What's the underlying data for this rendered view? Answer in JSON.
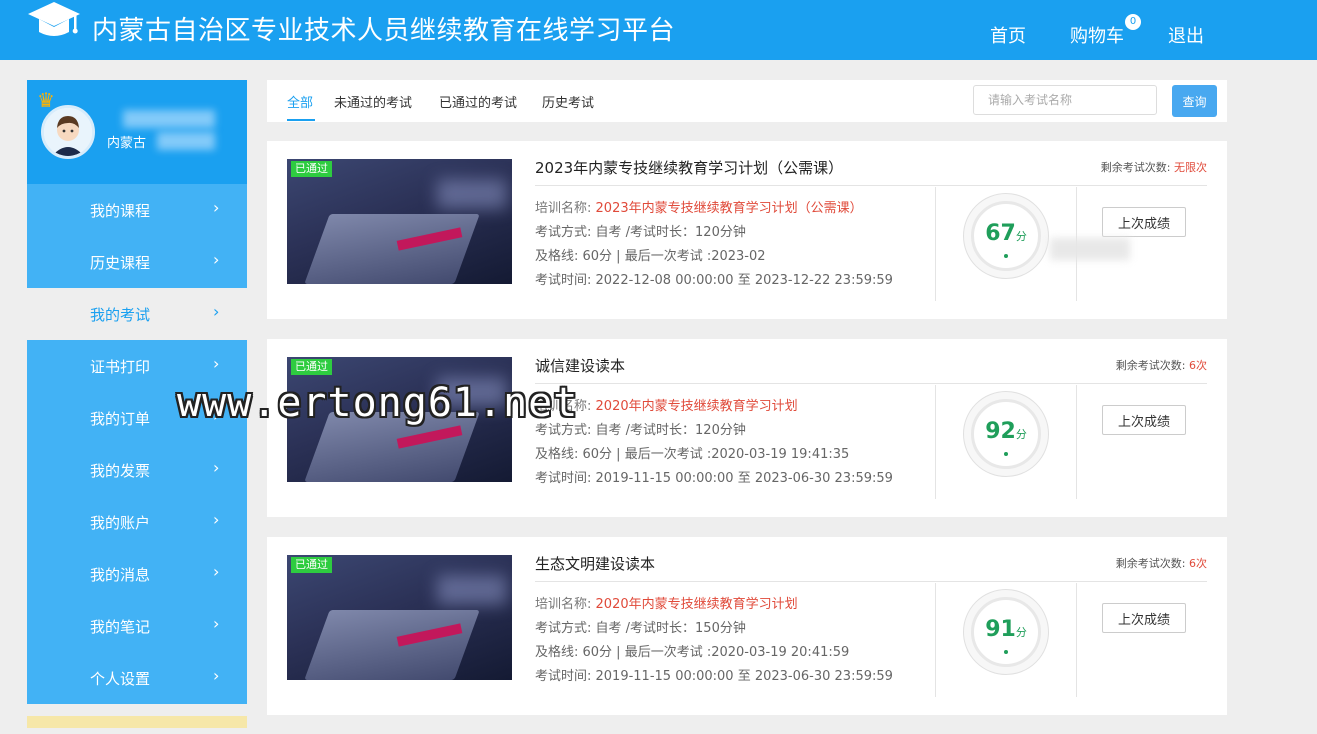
{
  "header": {
    "title": "内蒙古自治区专业技术人员继续教育在线学习平台",
    "logo_icon": "graduation-cap-icon",
    "nav": {
      "home": "首页",
      "cart": "购物车",
      "cart_count": "0",
      "logout": "退出"
    },
    "colors": {
      "primary": "#1aa0f0",
      "menu": "#42b2f5"
    }
  },
  "profile": {
    "username": "内蒙古",
    "avatar_icon": "user-avatar-icon",
    "badge_icon": "crown-icon"
  },
  "sidebar": {
    "items": [
      {
        "label": "我的课程"
      },
      {
        "label": "历史课程"
      },
      {
        "label": "我的考试"
      },
      {
        "label": "证书打印"
      },
      {
        "label": "我的订单"
      },
      {
        "label": "我的发票"
      },
      {
        "label": "我的账户"
      },
      {
        "label": "我的消息"
      },
      {
        "label": "我的笔记"
      },
      {
        "label": "个人设置"
      }
    ],
    "active_index": 2,
    "arrow": "›"
  },
  "tabs": {
    "items": [
      "全部",
      "未通过的考试",
      "已通过的考试",
      "历史考试"
    ],
    "active_index": 0
  },
  "search": {
    "placeholder": "请输入考试名称",
    "button": "查询"
  },
  "exams": [
    {
      "tag": "已通过",
      "title": "2023年内蒙专技继续教育学习计划（公需课）",
      "remain_label": "剩余考试次数:",
      "remain_value": "无限次",
      "training_label": "培训名称:",
      "training_name": "2023年内蒙专技继续教育学习计划（公需课）",
      "method_line": "考试方式: 自考 /考试时长：120分钟",
      "pass_line": "及格线: 60分 | 最后一次考试 :2023-02",
      "time_line": "考试时间: 2022-12-08 00:00:00 至 2023-12-22 23:59:59",
      "score": "67",
      "score_unit": "分",
      "button": "上次成绩"
    },
    {
      "tag": "已通过",
      "title": "诚信建设读本",
      "remain_label": "剩余考试次数:",
      "remain_value": "6次",
      "training_label": "培训名称:",
      "training_name": "2020年内蒙专技继续教育学习计划",
      "method_line": "考试方式: 自考 /考试时长：120分钟",
      "pass_line": "及格线: 60分 | 最后一次考试 :2020-03-19 19:41:35",
      "time_line": "考试时间: 2019-11-15 00:00:00 至 2023-06-30 23:59:59",
      "score": "92",
      "score_unit": "分",
      "button": "上次成绩"
    },
    {
      "tag": "已通过",
      "title": "生态文明建设读本",
      "remain_label": "剩余考试次数:",
      "remain_value": "6次",
      "training_label": "培训名称:",
      "training_name": "2020年内蒙专技继续教育学习计划",
      "method_line": "考试方式: 自考 /考试时长：150分钟",
      "pass_line": "及格线: 60分 | 最后一次考试 :2020-03-19 20:41:59",
      "time_line": "考试时间: 2019-11-15 00:00:00 至 2023-06-30 23:59:59",
      "score": "91",
      "score_unit": "分",
      "button": "上次成绩"
    }
  ],
  "watermark": "www.ertong61.net"
}
